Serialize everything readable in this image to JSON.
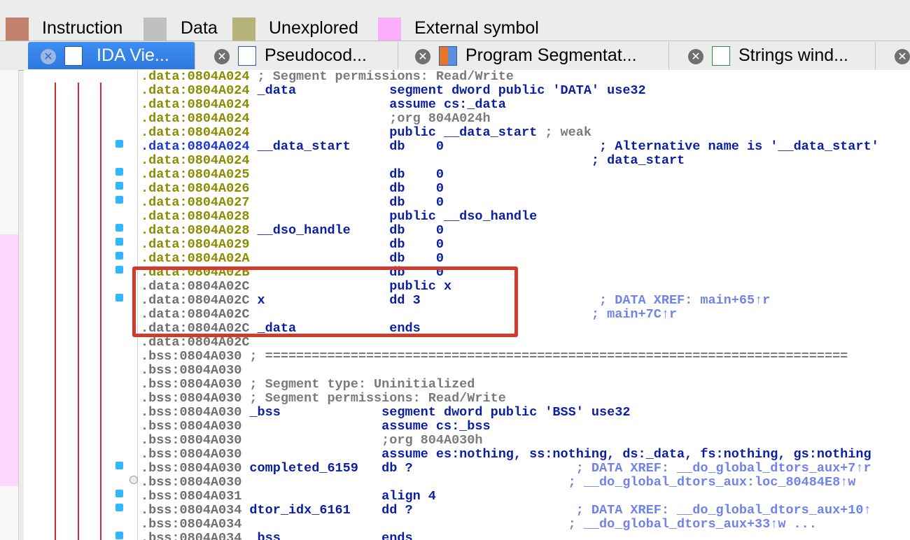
{
  "legend": [
    {
      "label": "Instruction",
      "color": "#c3816d"
    },
    {
      "label": "Data",
      "color": "#bfbfbf"
    },
    {
      "label": "Unexplored",
      "color": "#b5b27a"
    },
    {
      "label": "External symbol",
      "color": "#fbaefb"
    }
  ],
  "tabs": [
    {
      "label": "IDA Vie...",
      "icon": "ida-view-icon",
      "active": true
    },
    {
      "label": "Pseudocod...",
      "icon": "pseudocode-icon",
      "active": false
    },
    {
      "label": "Program Segmentat...",
      "icon": "segments-icon",
      "active": false
    },
    {
      "label": "Strings wind...",
      "icon": "strings-icon",
      "active": false
    }
  ],
  "lines": [
    {
      "seg": ".data",
      "addr": "0804A024",
      "text": " ; Segment permissions: Read/Write",
      "kind": "comment"
    },
    {
      "seg": ".data",
      "addr": "0804A024",
      "text": " _data            segment dword public 'DATA' use32",
      "kind": "code"
    },
    {
      "seg": ".data",
      "addr": "0804A024",
      "text": "                  assume cs:_data",
      "kind": "code"
    },
    {
      "seg": ".data",
      "addr": "0804A024",
      "text": "                  ;org 804A024h",
      "kind": "comment"
    },
    {
      "seg": ".data",
      "addr": "0804A024",
      "text": "                  public __data_start ; weak",
      "kind": "code"
    },
    {
      "seg": ".data",
      "addr": "0804A024",
      "text": " __data_start     db    0                    ; Alternative name is '__data_start'",
      "kind": "selected"
    },
    {
      "seg": ".data",
      "addr": "0804A024",
      "text": "                                            ; data_start",
      "kind": "code"
    },
    {
      "seg": ".data",
      "addr": "0804A025",
      "text": "                  db    0",
      "kind": "code"
    },
    {
      "seg": ".data",
      "addr": "0804A026",
      "text": "                  db    0",
      "kind": "code"
    },
    {
      "seg": ".data",
      "addr": "0804A027",
      "text": "                  db    0",
      "kind": "code"
    },
    {
      "seg": ".data",
      "addr": "0804A028",
      "text": "                  public __dso_handle",
      "kind": "code"
    },
    {
      "seg": ".data",
      "addr": "0804A028",
      "text": " __dso_handle     db    0",
      "kind": "code"
    },
    {
      "seg": ".data",
      "addr": "0804A029",
      "text": "                  db    0",
      "kind": "code"
    },
    {
      "seg": ".data",
      "addr": "0804A02A",
      "text": "                  db    0",
      "kind": "code"
    },
    {
      "seg": ".data",
      "addr": "0804A02B",
      "text": "                  db    0",
      "kind": "code"
    },
    {
      "seg": ".data",
      "addr": "0804A02C",
      "text": "                  public x",
      "kind": "gray"
    },
    {
      "seg": ".data",
      "addr": "0804A02C",
      "text": " x                dd 3                       ; DATA XREF: main+65↑r",
      "kind": "gray"
    },
    {
      "seg": ".data",
      "addr": "0804A02C",
      "text": "                                            ; main+7C↑r",
      "kind": "gray"
    },
    {
      "seg": ".data",
      "addr": "0804A02C",
      "text": " _data            ends",
      "kind": "gray"
    },
    {
      "seg": ".data",
      "addr": "0804A02C",
      "text": "",
      "kind": "gray"
    },
    {
      "seg": ".bss",
      "addr": "0804A030",
      "text": " ; ===========================================================================",
      "kind": "comment"
    },
    {
      "seg": ".bss",
      "addr": "0804A030",
      "text": "",
      "kind": "gray"
    },
    {
      "seg": ".bss",
      "addr": "0804A030",
      "text": " ; Segment type: Uninitialized",
      "kind": "comment"
    },
    {
      "seg": ".bss",
      "addr": "0804A030",
      "text": " ; Segment permissions: Read/Write",
      "kind": "comment"
    },
    {
      "seg": ".bss",
      "addr": "0804A030",
      "text": " _bss             segment dword public 'BSS' use32",
      "kind": "code"
    },
    {
      "seg": ".bss",
      "addr": "0804A030",
      "text": "                  assume cs:_bss",
      "kind": "code"
    },
    {
      "seg": ".bss",
      "addr": "0804A030",
      "text": "                  ;org 804A030h",
      "kind": "comment"
    },
    {
      "seg": ".bss",
      "addr": "0804A030",
      "text": "                  assume es:nothing, ss:nothing, ds:_data, fs:nothing, gs:nothing",
      "kind": "code"
    },
    {
      "seg": ".bss",
      "addr": "0804A030",
      "text": " completed_6159   db ?                     ; DATA XREF: __do_global_dtors_aux+7↑r",
      "kind": "code"
    },
    {
      "seg": ".bss",
      "addr": "0804A030",
      "text": "                                          ; __do_global_dtors_aux:loc_80484E8↑w",
      "kind": "code"
    },
    {
      "seg": ".bss",
      "addr": "0804A031",
      "text": "                  align 4",
      "kind": "code"
    },
    {
      "seg": ".bss",
      "addr": "0804A034",
      "text": " dtor_idx_6161    dd ?                     ; DATA XREF: __do_global_dtors_aux+10↑",
      "kind": "code"
    },
    {
      "seg": ".bss",
      "addr": "0804A034",
      "text": "                                          ; __do_global_dtors_aux+33↑w ...",
      "kind": "code"
    },
    {
      "seg": ".bss",
      "addr": "0804A034",
      "text": " _bss             ends",
      "kind": "code"
    }
  ]
}
